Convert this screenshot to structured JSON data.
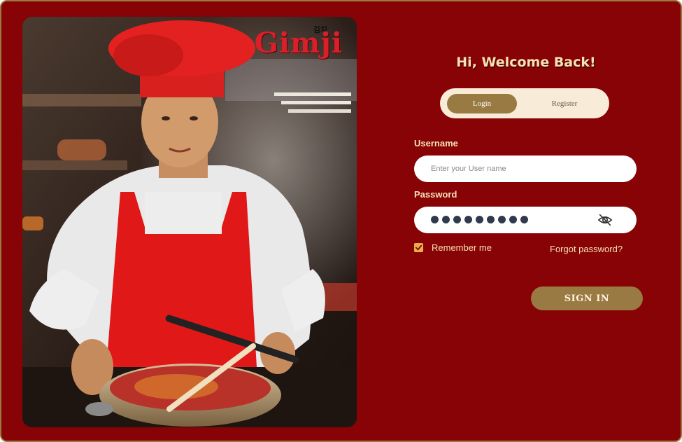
{
  "brand": {
    "logo_text": "Gimji",
    "logo_korean": "김치"
  },
  "form": {
    "welcome": "Hi, Welcome Back!",
    "tabs": [
      {
        "label": "Login",
        "active": true
      },
      {
        "label": "Register",
        "active": false
      }
    ],
    "username": {
      "label": "Username",
      "placeholder": "Enter your User name",
      "value": ""
    },
    "password": {
      "label": "Password",
      "masked_length": 9
    },
    "remember_me": {
      "label": "Remember me",
      "checked": true
    },
    "forgot_password": "Forgot password?",
    "sign_in": "SIGN IN"
  },
  "colors": {
    "background": "#880305",
    "accent": "#9a7a43",
    "text_light": "#f6e2b6",
    "toggle_bg": "#f8ecd8",
    "checkbox": "#e8b04a"
  }
}
